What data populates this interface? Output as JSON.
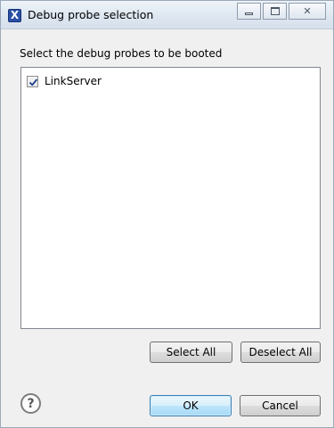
{
  "window": {
    "title": "Debug probe selection",
    "controls": {
      "minimize": "",
      "maximize": "",
      "close": "✕"
    }
  },
  "instruction": "Select the debug probes to be booted",
  "probes": [
    {
      "label": "LinkServer",
      "checked": true
    }
  ],
  "buttons": {
    "select_all": "Select All",
    "deselect_all": "Deselect All",
    "ok": "OK",
    "cancel": "Cancel"
  },
  "help": {
    "icon": "question-mark-icon",
    "glyph": "?"
  },
  "icons": {
    "app": "x-app-icon",
    "check": "checkmark-icon"
  }
}
